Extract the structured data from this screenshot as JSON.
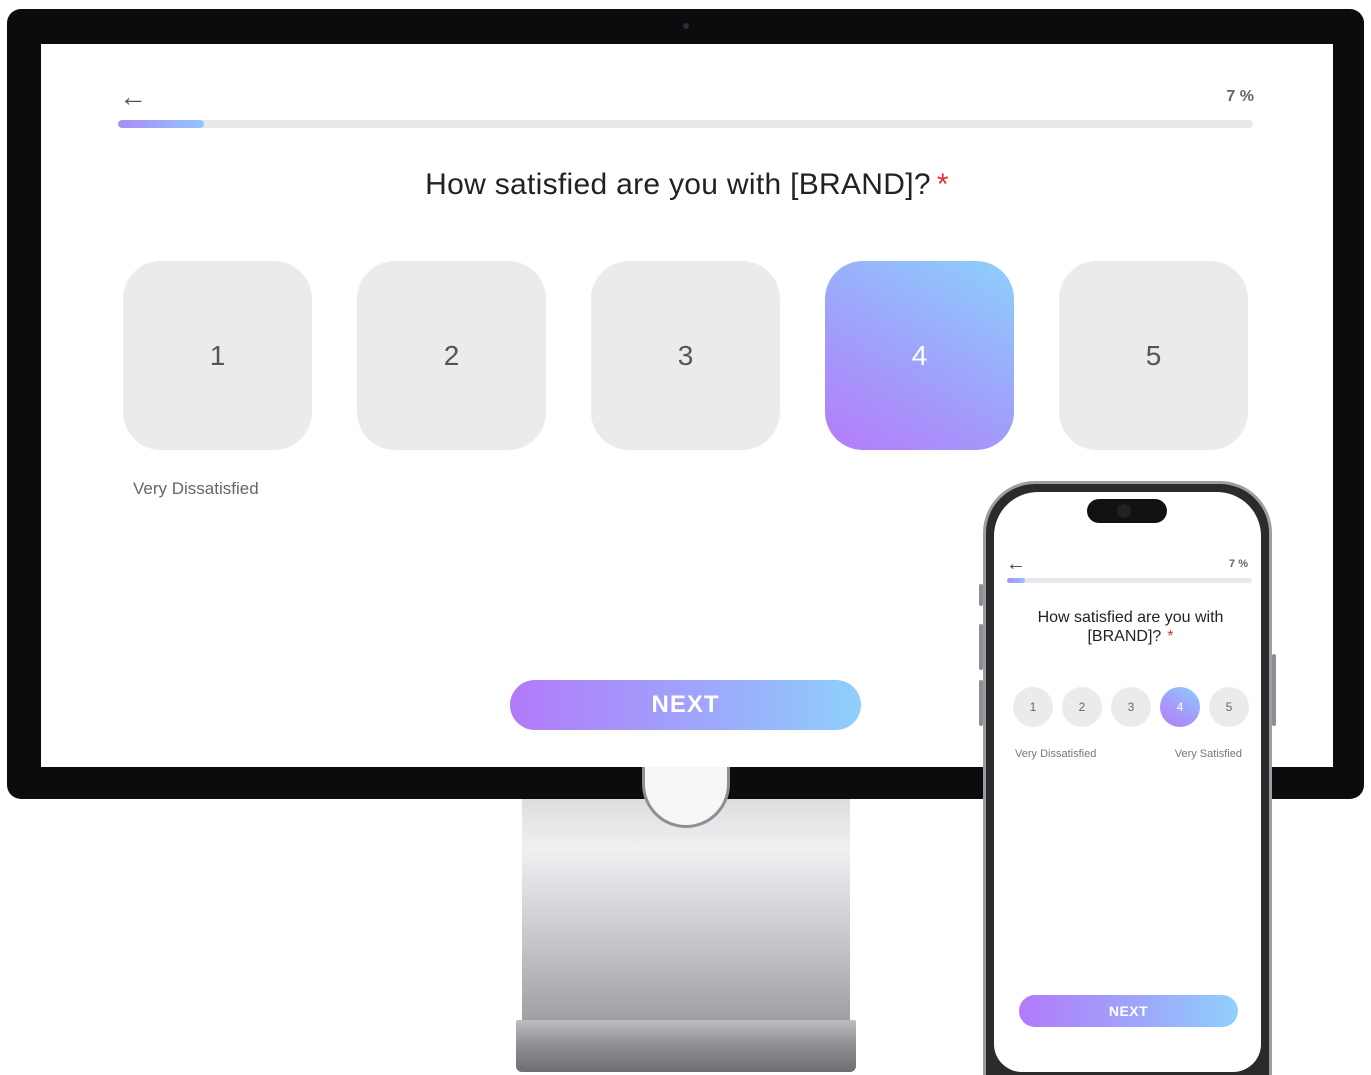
{
  "progress": {
    "percent_label": "7 %",
    "value_percent": 7
  },
  "survey": {
    "question": "How satisfied are you with [BRAND]?",
    "required_marker": "*",
    "options": [
      "1",
      "2",
      "3",
      "4",
      "5"
    ],
    "selected_option": "4",
    "label_low": "Very Dissatisfied",
    "label_high": "Very Satisfied"
  },
  "mobile": {
    "question": "How satisfied are you with [BRAND]?",
    "next_label": "NEXT"
  },
  "desktop": {
    "next_label": "NEXT"
  },
  "icons": {
    "back": "arrow-left-icon"
  },
  "colors": {
    "accent_start": "#b27afa",
    "accent_end": "#8fd0fb",
    "required": "#e62d2d",
    "option_bg": "#ebebeb"
  }
}
